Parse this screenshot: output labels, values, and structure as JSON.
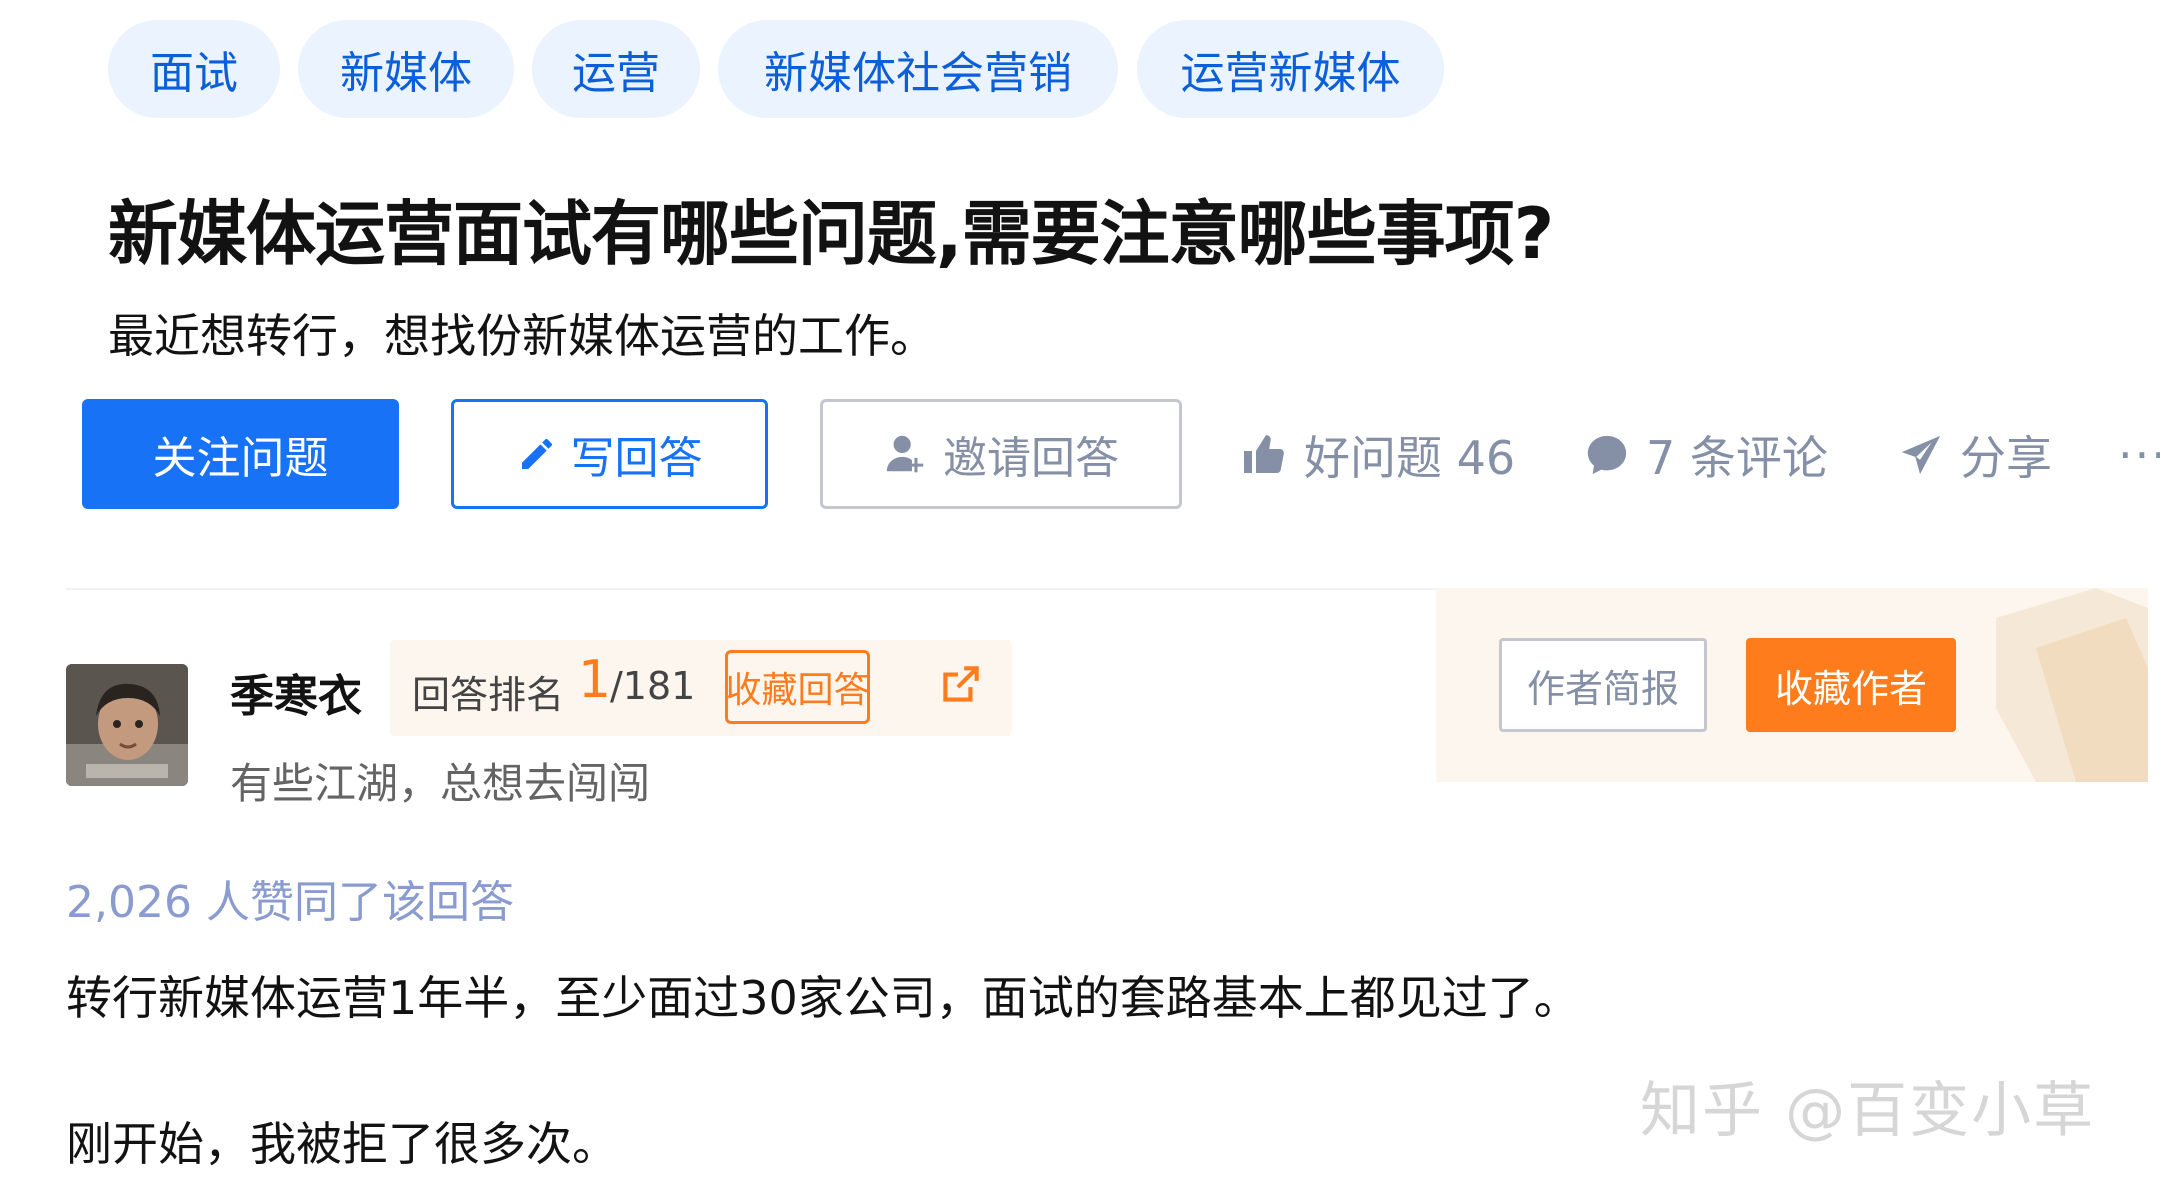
{
  "topics": [
    "面试",
    "新媒体",
    "运营",
    "新媒体社会营销",
    "运营新媒体"
  ],
  "question": {
    "title": "新媒体运营面试有哪些问题,需要注意哪些事项?",
    "detail": "最近想转行，想找份新媒体运营的工作。"
  },
  "actions": {
    "follow_label": "关注问题",
    "write_label": "写回答",
    "invite_label": "邀请回答",
    "good_question": "好问题 46",
    "comments": "7 条评论",
    "share": "分享",
    "more": "···"
  },
  "answer": {
    "author_name": "季寒衣",
    "rank_label": "回答排名",
    "rank_value": "1",
    "rank_total": "/181",
    "collect_answer_label": "收藏回答",
    "author_bio": "有些江湖，总想去闯闯",
    "brief_label": "作者简报",
    "collect_author_label": "收藏作者",
    "votes": "2,026 人赞同了该回答",
    "paragraphs": [
      "转行新媒体运营1年半，至少面过30家公司，面试的套路基本上都见过了。",
      "刚开始，我被拒了很多次。"
    ]
  },
  "watermark": "知乎 @百变小草",
  "colors": {
    "primary": "#1772f6",
    "accent_orange": "#ff7c1d",
    "tag_bg": "#ebf3ff",
    "muted": "#8590a6"
  }
}
